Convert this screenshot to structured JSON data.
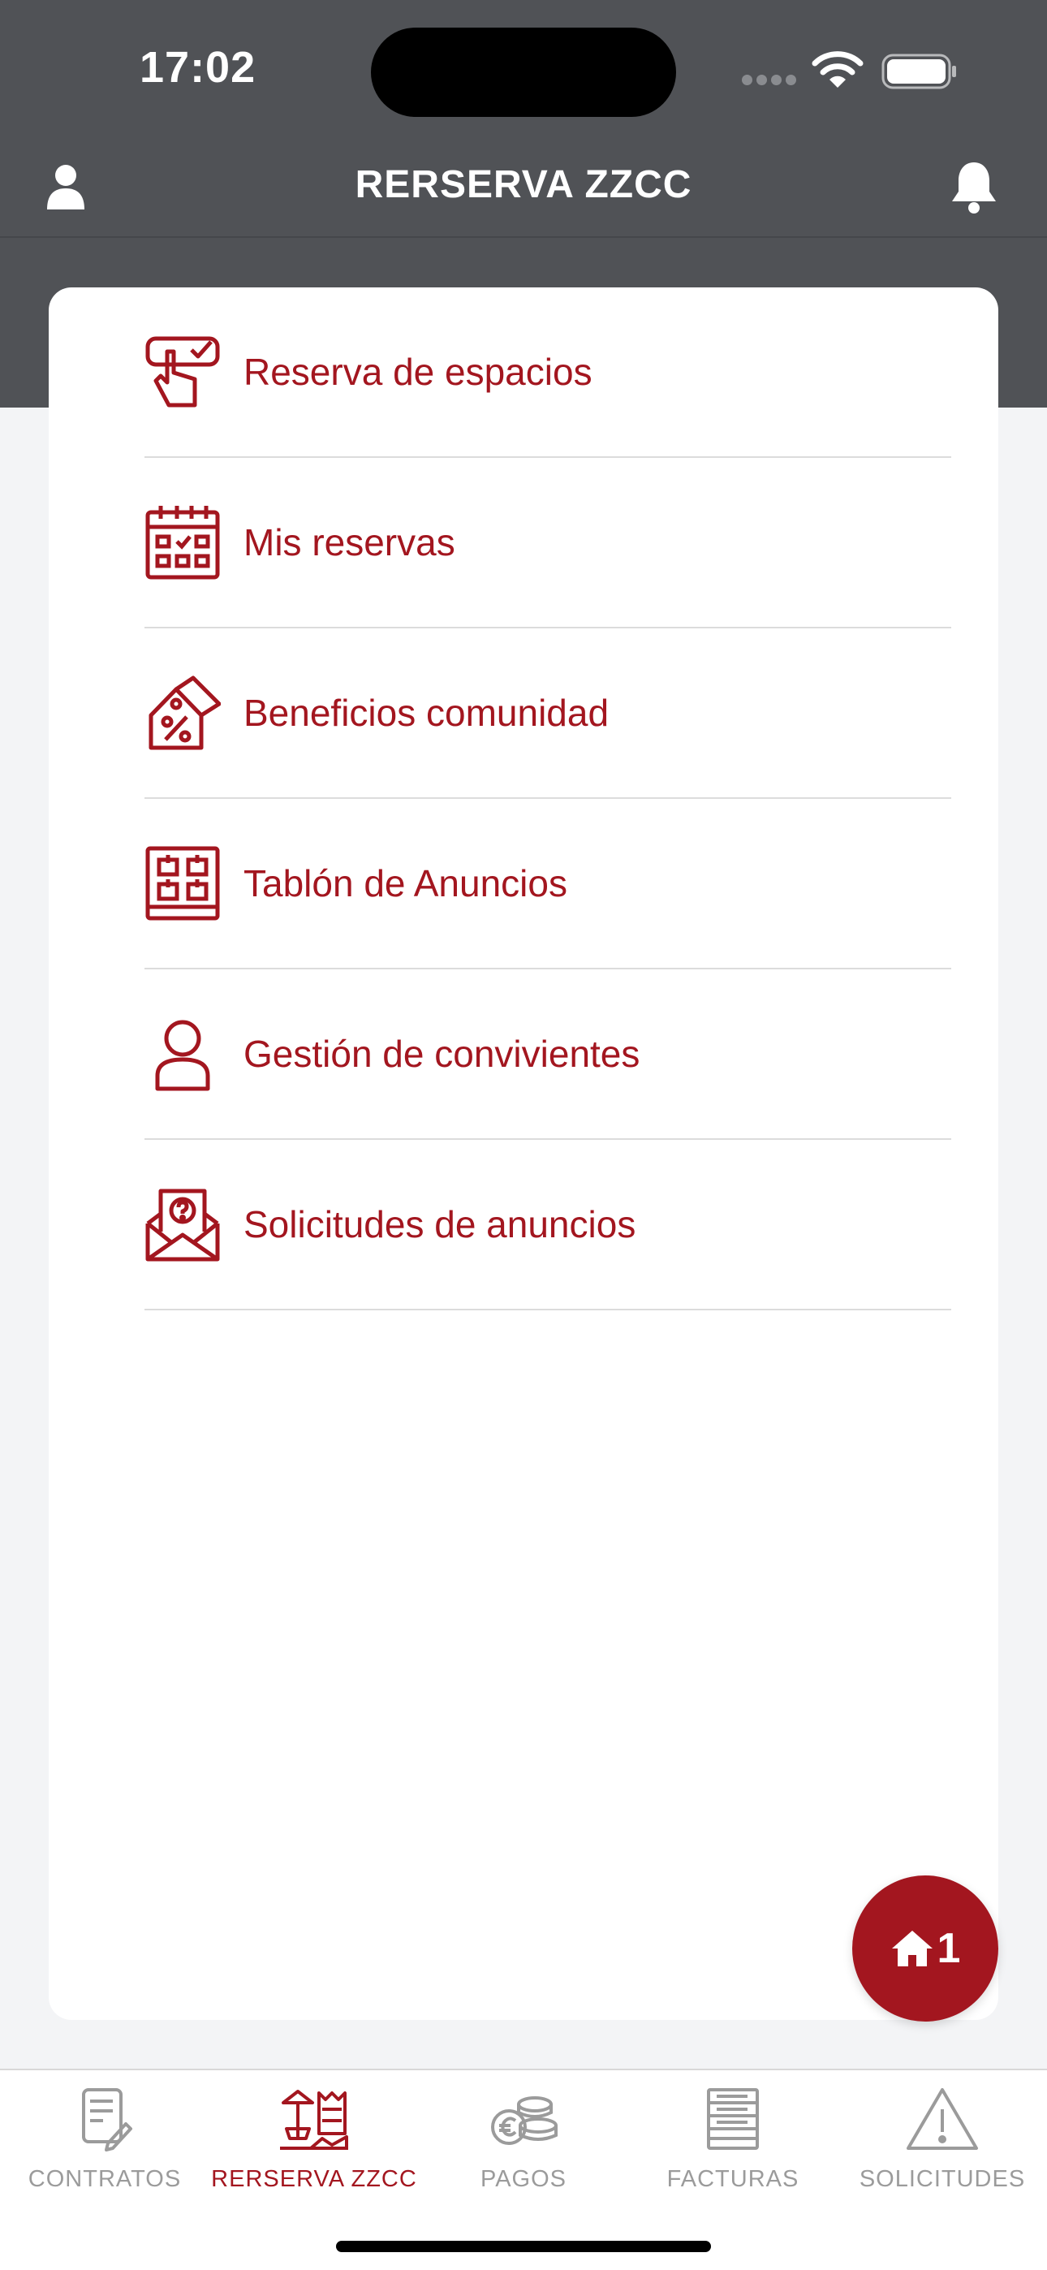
{
  "status_bar": {
    "time": "17:02"
  },
  "header": {
    "title": "RERSERVA ZZCC"
  },
  "menu": {
    "items": [
      {
        "label": "Reserva de espacios",
        "icon": "hand-tap-check-icon"
      },
      {
        "label": "Mis reservas",
        "icon": "calendar-check-icon"
      },
      {
        "label": "Beneficios comunidad",
        "icon": "discount-tag-icon"
      },
      {
        "label": "Tablón de Anuncios",
        "icon": "notice-board-icon"
      },
      {
        "label": "Gestión de convivientes",
        "icon": "person-icon"
      },
      {
        "label": "Solicitudes de anuncios",
        "icon": "envelope-question-icon"
      }
    ]
  },
  "fab": {
    "count": "1",
    "icon": "house-icon"
  },
  "tabs": [
    {
      "label": "CONTRATOS",
      "icon": "contract-icon",
      "active": false
    },
    {
      "label": "RERSERVA ZZCC",
      "icon": "community-facilities-icon",
      "active": true
    },
    {
      "label": "PAGOS",
      "icon": "coins-euro-icon",
      "active": false
    },
    {
      "label": "FACTURAS",
      "icon": "invoice-icon",
      "active": false
    },
    {
      "label": "SOLICITUDES",
      "icon": "warning-icon",
      "active": false
    }
  ],
  "colors": {
    "accent": "#a3161f",
    "header_bg": "#505256",
    "page_bg": "#f3f4f6",
    "inactive_tab": "#9b9b9b"
  }
}
